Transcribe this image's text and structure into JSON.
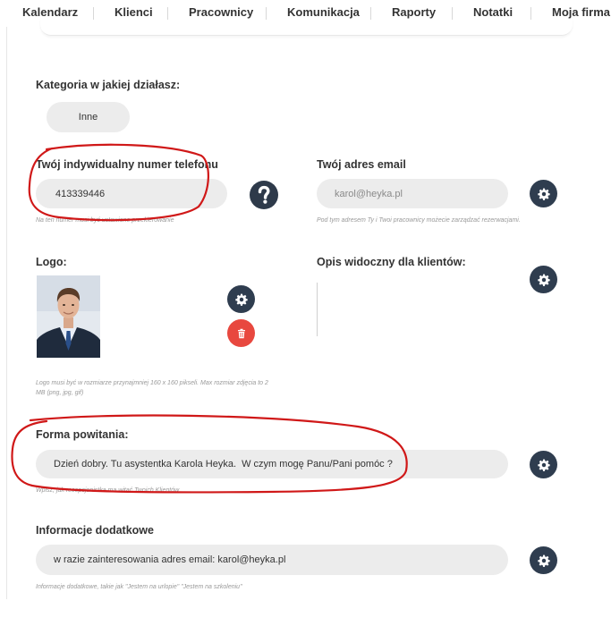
{
  "nav": {
    "items": [
      "Kalendarz",
      "Klienci",
      "Pracownicy",
      "Komunikacja",
      "Raporty",
      "Notatki",
      "Moja firma"
    ]
  },
  "category": {
    "label": "Kategoria w jakiej działasz:",
    "value": "Inne"
  },
  "phone": {
    "label": "Twój indywidualny numer telefonu",
    "value": "413339446",
    "hint": "Na ten numer musi być ustawione przekierowanie"
  },
  "email": {
    "label": "Twój adres email",
    "value": "karol@heyka.pl",
    "hint": "Pod tym adresem Ty i Twoi pracownicy możecie zarządzać rezerwacjami."
  },
  "logo": {
    "label": "Logo:",
    "hint_line1": "Logo musi być w rozmiarze przynajmniej 160 x 160 pikseli. Max rozmiar zdjęcia to 2",
    "hint_line2": "MB (png, jpg, gif)"
  },
  "description": {
    "label": "Opis widoczny dla klientów:"
  },
  "greeting": {
    "label": "Forma powitania:",
    "value": "Dzień dobry. Tu asystentka Karola Heyka.  W czym mogę Panu/Pani pomóc ?",
    "hint": "Wpisz, jak recepcjonistka ma witać Twoich Klientów"
  },
  "additional": {
    "label": "Informacje dodatkowe",
    "value": "w razie zainteresowania adres email: karol@heyka.pl",
    "hint": "Informacje dodatkowe, takie jak \"Jestem na urlopie\" \"Jestem na szkoleniu\""
  },
  "icons": {
    "settings": "gear-icon",
    "delete": "trash-icon",
    "help": "question-icon"
  },
  "colors": {
    "button_dark": "#2f3d4f",
    "button_delete": "#e8483f",
    "annotation": "#d01818",
    "field_bg": "#ececec"
  }
}
